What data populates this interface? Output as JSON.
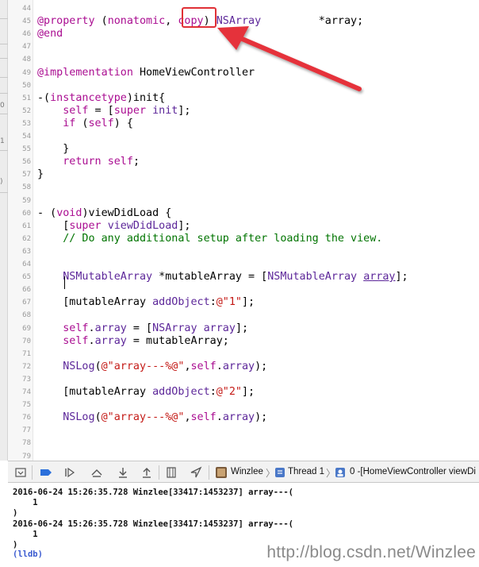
{
  "left_strip_marks": [
    "0",
    "1",
    ")"
  ],
  "gutter": [
    "44",
    "45",
    "46",
    "47",
    "48",
    "49",
    "50",
    "51",
    "52",
    "53",
    "54",
    "55",
    "56",
    "57",
    "58",
    "59",
    "60",
    "61",
    "62",
    "63",
    "64",
    "65",
    "66",
    "67",
    "68",
    "69",
    "70",
    "71",
    "72",
    "73",
    "74",
    "75",
    "76",
    "77",
    "78",
    "79"
  ],
  "code_lines": [
    {
      "ln": "44",
      "parts": []
    },
    {
      "ln": "45",
      "parts": [
        {
          "t": "@property",
          "c": "kw"
        },
        {
          "t": " (",
          "c": ""
        },
        {
          "t": "nonatomic",
          "c": "kw"
        },
        {
          "t": ", ",
          "c": ""
        },
        {
          "t": "copy",
          "c": "kw"
        },
        {
          "t": ") ",
          "c": ""
        },
        {
          "t": "NSArray",
          "c": "ty"
        },
        {
          "t": "         *array;",
          "c": ""
        }
      ]
    },
    {
      "ln": "46",
      "parts": [
        {
          "t": "@end",
          "c": "kw"
        }
      ]
    },
    {
      "ln": "47",
      "parts": []
    },
    {
      "ln": "48",
      "parts": []
    },
    {
      "ln": "49",
      "parts": [
        {
          "t": "@implementation",
          "c": "kw"
        },
        {
          "t": " HomeViewController",
          "c": ""
        }
      ]
    },
    {
      "ln": "50",
      "parts": []
    },
    {
      "ln": "51",
      "parts": [
        {
          "t": "-(",
          "c": ""
        },
        {
          "t": "instancetype",
          "c": "kw"
        },
        {
          "t": ")init{",
          "c": ""
        }
      ]
    },
    {
      "ln": "52",
      "parts": [
        {
          "t": "    ",
          "c": ""
        },
        {
          "t": "self",
          "c": "kw"
        },
        {
          "t": " = [",
          "c": ""
        },
        {
          "t": "super",
          "c": "kw"
        },
        {
          "t": " ",
          "c": ""
        },
        {
          "t": "init",
          "c": "ty"
        },
        {
          "t": "];",
          "c": ""
        }
      ]
    },
    {
      "ln": "53",
      "parts": [
        {
          "t": "    ",
          "c": ""
        },
        {
          "t": "if",
          "c": "kw"
        },
        {
          "t": " (",
          "c": ""
        },
        {
          "t": "self",
          "c": "kw"
        },
        {
          "t": ") {",
          "c": ""
        }
      ]
    },
    {
      "ln": "54",
      "parts": []
    },
    {
      "ln": "55",
      "parts": [
        {
          "t": "    }",
          "c": ""
        }
      ]
    },
    {
      "ln": "56",
      "parts": [
        {
          "t": "    ",
          "c": ""
        },
        {
          "t": "return",
          "c": "kw"
        },
        {
          "t": " ",
          "c": ""
        },
        {
          "t": "self",
          "c": "kw"
        },
        {
          "t": ";",
          "c": ""
        }
      ]
    },
    {
      "ln": "57",
      "parts": [
        {
          "t": "}",
          "c": ""
        }
      ]
    },
    {
      "ln": "58",
      "parts": []
    },
    {
      "ln": "59",
      "parts": []
    },
    {
      "ln": "60",
      "parts": [
        {
          "t": "- (",
          "c": ""
        },
        {
          "t": "void",
          "c": "kw"
        },
        {
          "t": ")viewDidLoad {",
          "c": ""
        }
      ]
    },
    {
      "ln": "61",
      "parts": [
        {
          "t": "    [",
          "c": ""
        },
        {
          "t": "super",
          "c": "kw"
        },
        {
          "t": " ",
          "c": ""
        },
        {
          "t": "viewDidLoad",
          "c": "ty"
        },
        {
          "t": "];",
          "c": ""
        }
      ]
    },
    {
      "ln": "62",
      "parts": [
        {
          "t": "    ",
          "c": ""
        },
        {
          "t": "// Do any additional setup after loading the view.",
          "c": "cm"
        }
      ]
    },
    {
      "ln": "63",
      "parts": []
    },
    {
      "ln": "64",
      "parts": []
    },
    {
      "ln": "65",
      "parts": [
        {
          "t": "    ",
          "c": ""
        },
        {
          "t": "NSMutableArray",
          "c": "ty"
        },
        {
          "t": " *mutableArray = [",
          "c": ""
        },
        {
          "t": "NSMutableArray",
          "c": "ty"
        },
        {
          "t": " ",
          "c": ""
        },
        {
          "t": "array",
          "c": "ty ul"
        },
        {
          "t": "];",
          "c": ""
        }
      ]
    },
    {
      "ln": "66",
      "parts": []
    },
    {
      "ln": "67",
      "parts": [
        {
          "t": "    [mutableArray ",
          "c": ""
        },
        {
          "t": "addObject",
          "c": "ty"
        },
        {
          "t": ":",
          "c": ""
        },
        {
          "t": "@\"1\"",
          "c": "str"
        },
        {
          "t": "];",
          "c": ""
        }
      ]
    },
    {
      "ln": "68",
      "parts": []
    },
    {
      "ln": "69",
      "parts": [
        {
          "t": "    ",
          "c": ""
        },
        {
          "t": "self",
          "c": "kw"
        },
        {
          "t": ".",
          "c": ""
        },
        {
          "t": "array",
          "c": "ty"
        },
        {
          "t": " = [",
          "c": ""
        },
        {
          "t": "NSArray",
          "c": "ty"
        },
        {
          "t": " ",
          "c": ""
        },
        {
          "t": "array",
          "c": "ty"
        },
        {
          "t": "];",
          "c": ""
        }
      ]
    },
    {
      "ln": "70",
      "parts": [
        {
          "t": "    ",
          "c": ""
        },
        {
          "t": "self",
          "c": "kw"
        },
        {
          "t": ".",
          "c": ""
        },
        {
          "t": "array",
          "c": "ty"
        },
        {
          "t": " = mutableArray;",
          "c": ""
        }
      ]
    },
    {
      "ln": "71",
      "parts": []
    },
    {
      "ln": "72",
      "parts": [
        {
          "t": "    ",
          "c": ""
        },
        {
          "t": "NSLog",
          "c": "ty"
        },
        {
          "t": "(",
          "c": ""
        },
        {
          "t": "@\"array---%@\"",
          "c": "str"
        },
        {
          "t": ",",
          "c": ""
        },
        {
          "t": "self",
          "c": "kw"
        },
        {
          "t": ".",
          "c": ""
        },
        {
          "t": "array",
          "c": "ty"
        },
        {
          "t": ");",
          "c": ""
        }
      ]
    },
    {
      "ln": "73",
      "parts": []
    },
    {
      "ln": "74",
      "parts": [
        {
          "t": "    [mutableArray ",
          "c": ""
        },
        {
          "t": "addObject",
          "c": "ty"
        },
        {
          "t": ":",
          "c": ""
        },
        {
          "t": "@\"2\"",
          "c": "str"
        },
        {
          "t": "];",
          "c": ""
        }
      ]
    },
    {
      "ln": "75",
      "parts": []
    },
    {
      "ln": "76",
      "parts": [
        {
          "t": "    ",
          "c": ""
        },
        {
          "t": "NSLog",
          "c": "ty"
        },
        {
          "t": "(",
          "c": ""
        },
        {
          "t": "@\"array---%@\"",
          "c": "str"
        },
        {
          "t": ",",
          "c": ""
        },
        {
          "t": "self",
          "c": "kw"
        },
        {
          "t": ".",
          "c": ""
        },
        {
          "t": "array",
          "c": "ty"
        },
        {
          "t": ");",
          "c": ""
        }
      ]
    },
    {
      "ln": "77",
      "parts": []
    },
    {
      "ln": "78",
      "parts": []
    },
    {
      "ln": "79",
      "parts": []
    }
  ],
  "colors": {
    "keyword": "#aa0d91",
    "type": "#5c2699",
    "string": "#c41a16",
    "comment": "#007400",
    "highlight": "#e03036",
    "lldb": "#3a5ad0"
  },
  "debug_bar": {
    "icons": [
      "toggle-console-icon",
      "breakpoint-icon",
      "continue-icon",
      "step-over-icon",
      "step-into-icon",
      "step-out-icon",
      "view-hierarchy-icon",
      "location-icon"
    ],
    "target": "Winzlee",
    "thread": "Thread 1",
    "frame": "0 -[HomeViewController viewDi"
  },
  "console": {
    "lines": [
      "2016-06-24 15:26:35.728 Winzlee[33417:1453237] array---(",
      "    1",
      ")",
      "2016-06-24 15:26:35.728 Winzlee[33417:1453237] array---(",
      "    1",
      ")"
    ],
    "prompt": "(lldb)"
  },
  "watermark": "http://blog.csdn.net/Winzlee"
}
